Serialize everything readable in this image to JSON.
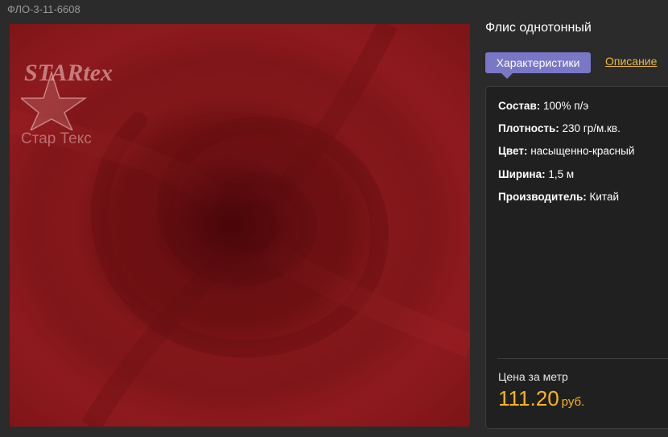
{
  "product": {
    "sku": "ФЛО-3-11-6608",
    "title": "Флис однотонный"
  },
  "image": {
    "logo_wordmark": "STARtex",
    "logo_caption": "Стар Текс"
  },
  "tabs": {
    "active": "Характеристики",
    "other": "Описание"
  },
  "specs": [
    {
      "label": "Состав:",
      "value": "100% п/э"
    },
    {
      "label": "Плотность:",
      "value": "230 гр/м.кв."
    },
    {
      "label": "Цвет:",
      "value": "насыщенно-красный"
    },
    {
      "label": "Ширина:",
      "value": "1,5 м"
    },
    {
      "label": "Производитель:",
      "value": "Китай"
    }
  ],
  "price": {
    "label": "Цена за метр",
    "amount": "111.20",
    "currency": "руб."
  },
  "colors": {
    "accent_tab": "#7a77c7",
    "link": "#e8b93c",
    "price": "#f5b61c",
    "fabric": "#8e1a1e"
  }
}
